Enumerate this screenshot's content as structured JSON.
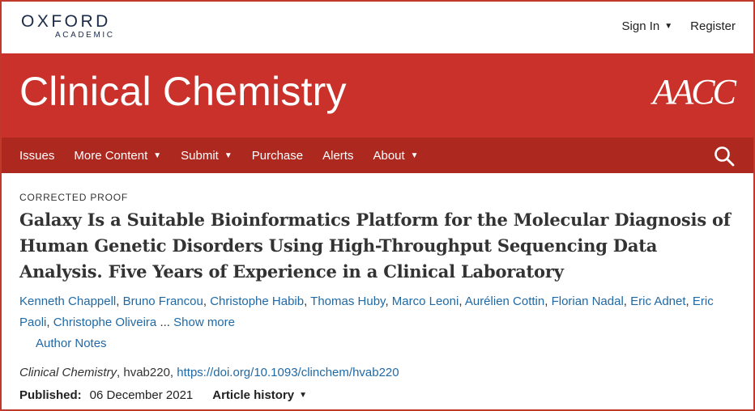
{
  "header": {
    "logo_main": "OXFORD",
    "logo_sub": "ACADEMIC",
    "sign_in": "Sign In",
    "register": "Register"
  },
  "banner": {
    "journal_title": "Clinical Chemistry",
    "aacc": "AACC",
    "color": "#c9312a"
  },
  "nav": {
    "items": [
      {
        "label": "Issues",
        "has_dropdown": false
      },
      {
        "label": "More Content",
        "has_dropdown": true
      },
      {
        "label": "Submit",
        "has_dropdown": true
      },
      {
        "label": "Purchase",
        "has_dropdown": false
      },
      {
        "label": "Alerts",
        "has_dropdown": false
      },
      {
        "label": "About",
        "has_dropdown": true
      }
    ],
    "search_icon": "search-icon",
    "color": "#ad2920"
  },
  "article": {
    "label": "CORRECTED PROOF",
    "title": "Galaxy Is a Suitable Bioinformatics Platform for the Molecular Diagnosis of Human Genetic Disorders Using High-Throughput Sequencing Data Analysis. Five Years of Experience in a Clinical Laboratory",
    "authors": [
      "Kenneth Chappell",
      "Bruno Francou",
      "Christophe Habib",
      "Thomas Huby",
      "Marco Leoni",
      "Aurélien Cottin",
      "Florian Nadal",
      "Eric Adnet",
      "Eric Paoli",
      "Christophe Oliveira"
    ],
    "ellipsis": "...",
    "show_more": "Show more",
    "author_notes": "Author Notes",
    "journal": "Clinical Chemistry",
    "article_id": ", hvab220, ",
    "doi": "https://doi.org/10.1093/clinchem/hvab220",
    "published_label": "Published:",
    "published_date": "06 December 2021",
    "article_history": "Article history",
    "link_color": "#1f69a6"
  }
}
